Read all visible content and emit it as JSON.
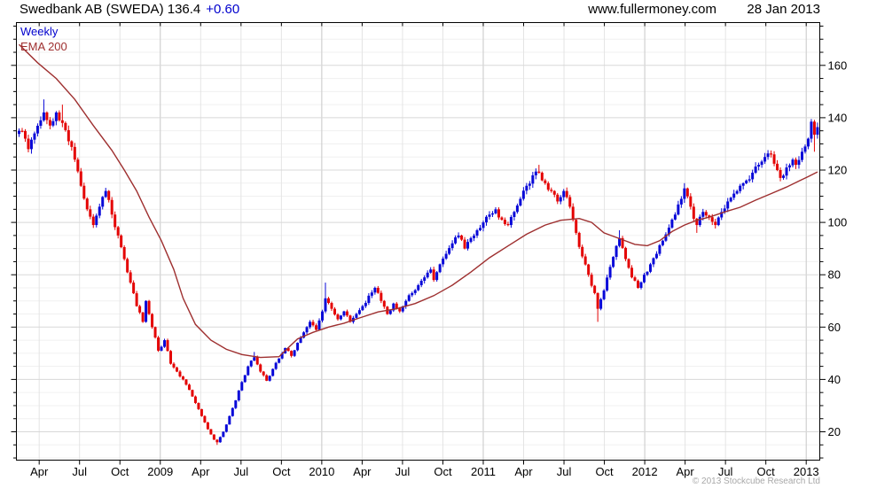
{
  "header": {
    "title": "Swedbank AB (SWEDA) 136.4",
    "change": "+0.60",
    "website": "www.fullermoney.com",
    "date": "28 Jan 2013"
  },
  "legend": {
    "interval": "Weekly",
    "ema": "EMA 200"
  },
  "footer": {
    "copyright": "© 2013 Stockcube Research Ltd"
  },
  "chart_data": {
    "type": "candlestick",
    "title": "Swedbank AB (SWEDA)",
    "interval": "Weekly",
    "last_price": 136.4,
    "change": 0.6,
    "date": "28 Jan 2013",
    "start": "Feb 2008",
    "end": "Jan 2013",
    "weeks_total": 259,
    "ylim": [
      9,
      176
    ],
    "y_ticks": [
      20,
      40,
      60,
      80,
      100,
      120,
      140,
      160
    ],
    "y_minor_step": 5,
    "x_labels": [
      "Apr",
      "Jul",
      "Oct",
      "2009",
      "Apr",
      "Jul",
      "Oct",
      "2010",
      "Apr",
      "Jul",
      "Oct",
      "2011",
      "Apr",
      "Jul",
      "Oct",
      "2012",
      "Apr",
      "Jul",
      "Oct",
      "2013"
    ],
    "grid": true,
    "series": [
      {
        "name": "Weekly close (keypoints: [week, price])",
        "role": "candles"
      },
      {
        "name": "EMA 200 (keypoints: [week, value])",
        "role": "overlay-line"
      }
    ],
    "close_keypoints": [
      [
        0,
        135
      ],
      [
        2,
        132
      ],
      [
        3,
        128
      ],
      [
        5,
        134
      ],
      [
        7,
        139
      ],
      [
        8,
        142
      ],
      [
        10,
        137
      ],
      [
        12,
        142
      ],
      [
        14,
        138
      ],
      [
        16,
        131
      ],
      [
        18,
        124
      ],
      [
        20,
        114
      ],
      [
        22,
        105
      ],
      [
        24,
        99
      ],
      [
        26,
        106
      ],
      [
        28,
        112
      ],
      [
        30,
        103
      ],
      [
        32,
        95
      ],
      [
        34,
        86
      ],
      [
        36,
        77
      ],
      [
        38,
        68
      ],
      [
        40,
        62
      ],
      [
        41,
        70
      ],
      [
        43,
        60
      ],
      [
        45,
        51
      ],
      [
        47,
        55
      ],
      [
        49,
        46
      ],
      [
        51,
        43
      ],
      [
        53,
        40
      ],
      [
        55,
        36
      ],
      [
        57,
        31
      ],
      [
        59,
        26
      ],
      [
        61,
        21
      ],
      [
        63,
        17
      ],
      [
        64,
        16
      ],
      [
        66,
        20
      ],
      [
        68,
        26
      ],
      [
        70,
        32
      ],
      [
        72,
        39
      ],
      [
        74,
        45
      ],
      [
        76,
        48.5
      ],
      [
        78,
        43
      ],
      [
        80,
        39.5
      ],
      [
        82,
        44
      ],
      [
        84,
        48
      ],
      [
        86,
        52
      ],
      [
        88,
        49
      ],
      [
        90,
        54
      ],
      [
        92,
        58
      ],
      [
        94,
        62
      ],
      [
        96,
        59
      ],
      [
        98,
        66
      ],
      [
        99,
        71
      ],
      [
        101,
        67
      ],
      [
        103,
        63
      ],
      [
        105,
        66
      ],
      [
        107,
        62
      ],
      [
        109,
        65
      ],
      [
        111,
        68
      ],
      [
        113,
        72
      ],
      [
        115,
        75
      ],
      [
        117,
        70
      ],
      [
        119,
        65
      ],
      [
        121,
        69
      ],
      [
        123,
        66
      ],
      [
        125,
        70
      ],
      [
        127,
        73
      ],
      [
        129,
        76
      ],
      [
        131,
        79
      ],
      [
        133,
        82
      ],
      [
        134,
        78
      ],
      [
        136,
        84
      ],
      [
        138,
        88
      ],
      [
        140,
        92
      ],
      [
        142,
        95
      ],
      [
        144,
        90
      ],
      [
        146,
        94
      ],
      [
        148,
        97
      ],
      [
        150,
        100
      ],
      [
        152,
        103
      ],
      [
        154,
        105
      ],
      [
        156,
        101
      ],
      [
        158,
        99
      ],
      [
        160,
        104
      ],
      [
        162,
        109
      ],
      [
        164,
        114
      ],
      [
        166,
        118
      ],
      [
        168,
        119
      ],
      [
        170,
        115
      ],
      [
        172,
        112
      ],
      [
        174,
        108
      ],
      [
        176,
        112
      ],
      [
        178,
        106
      ],
      [
        180,
        96
      ],
      [
        182,
        87
      ],
      [
        184,
        80
      ],
      [
        186,
        73
      ],
      [
        187,
        67
      ],
      [
        189,
        74
      ],
      [
        191,
        83
      ],
      [
        193,
        91
      ],
      [
        194,
        94
      ],
      [
        196,
        86
      ],
      [
        198,
        79
      ],
      [
        200,
        75
      ],
      [
        202,
        80
      ],
      [
        204,
        84
      ],
      [
        206,
        88
      ],
      [
        208,
        93
      ],
      [
        210,
        98
      ],
      [
        212,
        103
      ],
      [
        214,
        109
      ],
      [
        215,
        113
      ],
      [
        217,
        106
      ],
      [
        219,
        99
      ],
      [
        221,
        104
      ],
      [
        223,
        102
      ],
      [
        225,
        99
      ],
      [
        227,
        104
      ],
      [
        229,
        108
      ],
      [
        231,
        111
      ],
      [
        233,
        114
      ],
      [
        235,
        116
      ],
      [
        237,
        119
      ],
      [
        239,
        122
      ],
      [
        241,
        125
      ],
      [
        243,
        126
      ],
      [
        245,
        120
      ],
      [
        246,
        117
      ],
      [
        248,
        121
      ],
      [
        250,
        124
      ],
      [
        251,
        122
      ],
      [
        253,
        127
      ],
      [
        254,
        129
      ],
      [
        255,
        132
      ],
      [
        256,
        138.5
      ],
      [
        257,
        133.5
      ],
      [
        258,
        136.4
      ]
    ],
    "wick_overrides": {
      "8": {
        "h": 147
      },
      "14": {
        "h": 145
      },
      "64": {
        "l": 15
      },
      "76": {
        "h": 50.5
      },
      "99": {
        "h": 77
      },
      "168": {
        "h": 122
      },
      "187": {
        "l": 62
      },
      "194": {
        "h": 97
      },
      "215": {
        "h": 115
      },
      "219": {
        "l": 96
      },
      "243": {
        "h": 127.5
      },
      "256": {
        "h": 139.5
      },
      "257": {
        "l": 127
      },
      "258": {
        "l": 132
      }
    },
    "ema_keypoints": [
      [
        0,
        168
      ],
      [
        6,
        161
      ],
      [
        12,
        155
      ],
      [
        18,
        147
      ],
      [
        24,
        137
      ],
      [
        30,
        127.5
      ],
      [
        34,
        120
      ],
      [
        38,
        112
      ],
      [
        42,
        102
      ],
      [
        46,
        93
      ],
      [
        50,
        82
      ],
      [
        53,
        71
      ],
      [
        57,
        61
      ],
      [
        62,
        55
      ],
      [
        67,
        51.5
      ],
      [
        72,
        49.5
      ],
      [
        78,
        48.4
      ],
      [
        84,
        48.7
      ],
      [
        86,
        51
      ],
      [
        90,
        55.5
      ],
      [
        95,
        58
      ],
      [
        100,
        60
      ],
      [
        105,
        61.5
      ],
      [
        110,
        63.5
      ],
      [
        116,
        65.8
      ],
      [
        122,
        67
      ],
      [
        128,
        69
      ],
      [
        134,
        72
      ],
      [
        140,
        76
      ],
      [
        146,
        81
      ],
      [
        152,
        86.5
      ],
      [
        158,
        91
      ],
      [
        164,
        95.5
      ],
      [
        170,
        99
      ],
      [
        175,
        100.8
      ],
      [
        181,
        101.5
      ],
      [
        185,
        100
      ],
      [
        189,
        96
      ],
      [
        194,
        93.8
      ],
      [
        199,
        91.6
      ],
      [
        203,
        91.1
      ],
      [
        207,
        93
      ],
      [
        211,
        96.5
      ],
      [
        215,
        99
      ],
      [
        219,
        100.8
      ],
      [
        223,
        102
      ],
      [
        228,
        104
      ],
      [
        233,
        105.8
      ],
      [
        238,
        108.5
      ],
      [
        243,
        111
      ],
      [
        248,
        113.5
      ],
      [
        252,
        115.8
      ],
      [
        255,
        117.5
      ],
      [
        258,
        119.3
      ]
    ],
    "colors": {
      "up_candle": "#0808d8",
      "down_candle": "#e40404",
      "ema_line": "#9e2f2f",
      "weekly_label": "#0000cd",
      "change_text": "#0000cd",
      "grid_minor": "#f0f0f0",
      "grid_major": "#d8d8d8",
      "grid_quarter": "#e4e4e4",
      "grid_year": "#c8c8c8",
      "border": "#000000",
      "copyright_text": "#a8a8a8"
    }
  }
}
